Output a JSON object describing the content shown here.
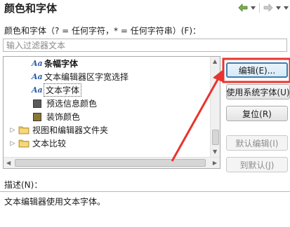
{
  "header": {
    "title": "颜色和字体",
    "back_icon": "back-arrow-icon",
    "forward_icon": "forward-arrow-icon",
    "menu_icon": "chevron-down-icon"
  },
  "filter": {
    "label": "颜色和字体（? = 任何字符，* = 任何字符串）(F)：",
    "placeholder": "输入过滤器文本",
    "value": ""
  },
  "tree": {
    "items": [
      {
        "label": "条幅字体",
        "icon": "font-aa-icon",
        "bold": true,
        "selected": false
      },
      {
        "label": "文本编辑器区字宽选择",
        "icon": "font-aa-icon",
        "bold": false,
        "selected": false
      },
      {
        "label": "文本字体",
        "icon": "font-aa-icon",
        "bold": false,
        "selected": true
      },
      {
        "label": "预选信息颜色",
        "icon": "color-swatch-icon",
        "color": "#5a5a5a",
        "bold": false,
        "selected": false
      },
      {
        "label": "装饰颜色",
        "icon": "color-swatch-icon",
        "color": "#8b7530",
        "bold": false,
        "selected": false
      },
      {
        "label": "视图和编辑器文件夹",
        "icon": "folder-icon",
        "bold": false,
        "selected": false,
        "expandable": true
      },
      {
        "label": "文本比较",
        "icon": "folder-icon",
        "bold": false,
        "selected": false,
        "expandable": true
      }
    ]
  },
  "buttons": {
    "edit": "编辑(E)...",
    "use_system_font": "使用系统字体(U)",
    "reset": "复位(R)",
    "default_edit": "默认编辑(I)",
    "goto_default": "到默认(J)"
  },
  "description": {
    "label": "描述(N)：",
    "text": "文本编辑器使用文本字体。"
  },
  "colors": {
    "accent": "#3c7fb1",
    "annotation": "#e8342e"
  }
}
